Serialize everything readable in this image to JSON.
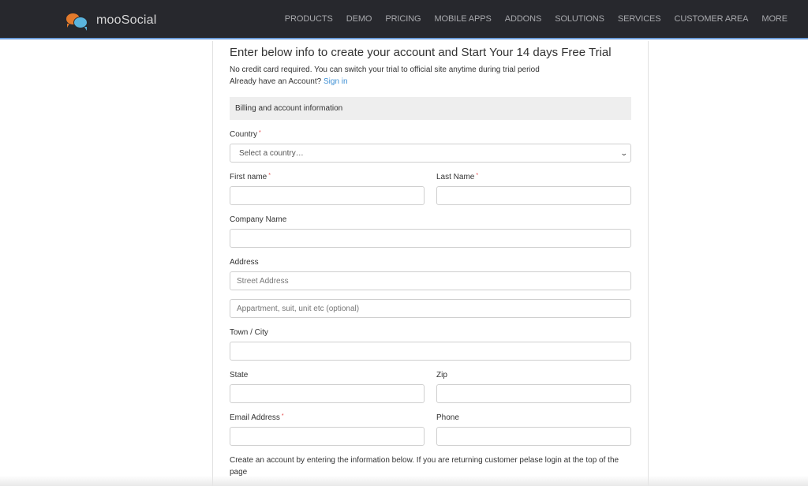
{
  "header": {
    "brand": "mooSocial",
    "nav": [
      "PRODUCTS",
      "DEMO",
      "PRICING",
      "MOBILE APPS",
      "ADDONS",
      "SOLUTIONS",
      "SERVICES",
      "CUSTOMER AREA",
      "MORE"
    ]
  },
  "intro": {
    "title": "Enter below info to create your account and Start Your 14 days Free Trial",
    "line1": "No credit card required. You can switch your trial to official site anytime during trial period",
    "line2_prefix": "Already have an Account?",
    "sign_in_link": "Sign in"
  },
  "section": {
    "title": "Billing and account information"
  },
  "form": {
    "required_mark": "*",
    "country": {
      "label": "Country",
      "value": "Select a country…",
      "required": true
    },
    "first_name": {
      "label": "First name",
      "value": "",
      "required": true
    },
    "last_name": {
      "label": "Last Name",
      "value": "",
      "required": true
    },
    "company": {
      "label": "Company Name",
      "value": ""
    },
    "address": {
      "label": "Address",
      "street_placeholder": "Street Address",
      "apt_placeholder": "Appartment, suit, unit etc (optional)"
    },
    "city": {
      "label": "Town / City",
      "value": ""
    },
    "state": {
      "label": "State",
      "value": ""
    },
    "zip": {
      "label": "Zip",
      "value": ""
    },
    "email": {
      "label": "Email Address",
      "value": "",
      "required": true
    },
    "phone": {
      "label": "Phone",
      "value": ""
    }
  },
  "note": "Create an account by entering the information below. If you are returning customer pelase login at the top of the page",
  "colors": {
    "topbar": "#27282d",
    "accent_border": "#6a9bd8",
    "link": "#3d8fd4",
    "required": "#e23b3b",
    "logo_orange": "#e27a2c",
    "logo_blue": "#5ab4dd"
  }
}
